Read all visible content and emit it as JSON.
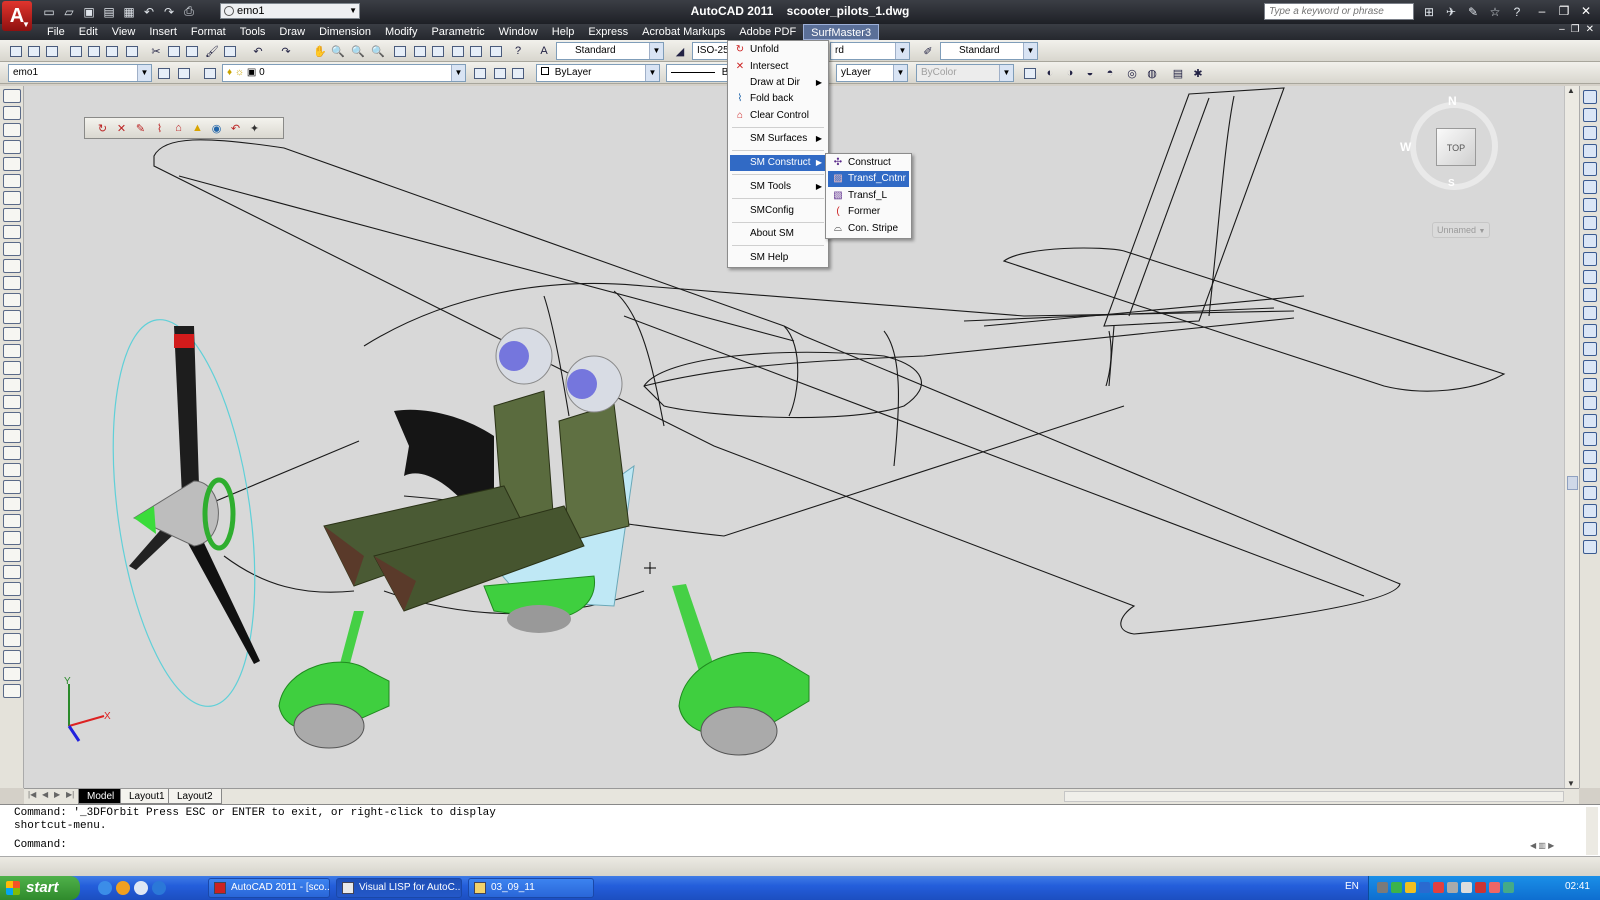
{
  "window": {
    "title": "AutoCAD 2011    scooter_pilots_1.dwg",
    "app_icon": "autocad-logo-icon",
    "workspace_combo": "emo1",
    "search_placeholder": "Type a keyword or phrase"
  },
  "menubar": {
    "items": [
      "File",
      "Edit",
      "View",
      "Insert",
      "Format",
      "Tools",
      "Draw",
      "Dimension",
      "Modify",
      "Parametric",
      "Window",
      "Help",
      "Express",
      "Acrobat Markups",
      "Adobe PDF",
      "SurfMaster3"
    ],
    "active": "SurfMaster3"
  },
  "toolbar1": {
    "text_style": "Standard",
    "dim_style": "ISO-25",
    "table_style_partial": "rd",
    "multileader_style": "Standard"
  },
  "toolbar2": {
    "layer_state": "emo1",
    "current_layer": "0",
    "color": "ByLayer",
    "linetype": "ByL",
    "lineweight": "yLayer",
    "plot_style": "ByColor"
  },
  "surfmaster_menu": {
    "items": [
      {
        "label": "Unfold",
        "icon": "unfold-icon",
        "submenu": false
      },
      {
        "label": "Intersect",
        "icon": "intersect-icon",
        "submenu": false
      },
      {
        "label": "Draw at Dir",
        "icon": "",
        "submenu": true
      },
      {
        "label": "Fold back",
        "icon": "fold-back-icon",
        "submenu": false
      },
      {
        "label": "Clear Control",
        "icon": "clear-control-icon",
        "submenu": false
      },
      {
        "label": "SM Surfaces",
        "icon": "",
        "submenu": true
      },
      {
        "label": "SM Construct",
        "icon": "",
        "submenu": true,
        "highlighted": true
      },
      {
        "label": "SM Tools",
        "icon": "",
        "submenu": true
      },
      {
        "label": "SMConfig",
        "icon": "",
        "submenu": false
      },
      {
        "label": "About SM",
        "icon": "",
        "submenu": false
      },
      {
        "label": "SM Help",
        "icon": "",
        "submenu": false
      }
    ]
  },
  "construct_submenu": {
    "items": [
      {
        "label": "Construct",
        "icon": "construct-icon"
      },
      {
        "label": "Transf_Cntnr",
        "icon": "transf-cntnr-icon",
        "highlighted": true
      },
      {
        "label": "Transf_L",
        "icon": "transf-l-icon"
      },
      {
        "label": "Former",
        "icon": "former-icon"
      },
      {
        "label": "Con. Stripe",
        "icon": "con-stripe-icon"
      }
    ]
  },
  "viewcube": {
    "face": "TOP",
    "north": "N",
    "south": "S",
    "west": "W",
    "ucs_combo": "Unnamed"
  },
  "layout_tabs": [
    "Model",
    "Layout1",
    "Layout2"
  ],
  "active_layout": "Model",
  "command": {
    "history": [
      "Command: '_3DFOrbit Press ESC or ENTER to exit, or right-click to display",
      "shortcut-menu."
    ],
    "prompt": "Command:",
    "input_value": ""
  },
  "taskbar": {
    "start_label": "start",
    "tasks": [
      {
        "label": "AutoCAD 2011 - [sco...",
        "active": false
      },
      {
        "label": "Visual LISP for AutoC...",
        "active": true
      },
      {
        "label": "03_09_11",
        "active": false
      }
    ],
    "language": "EN",
    "clock": "02:41"
  },
  "colors": {
    "title_bar": "#2b2e35",
    "menu_highlight": "#316ac5",
    "canvas_bg": "#d8d8d8",
    "taskbar": "#245edb",
    "start_button": "#3a9a35",
    "model_green": "#3fcf3f",
    "pilot_uniform": "#4a5a34"
  }
}
